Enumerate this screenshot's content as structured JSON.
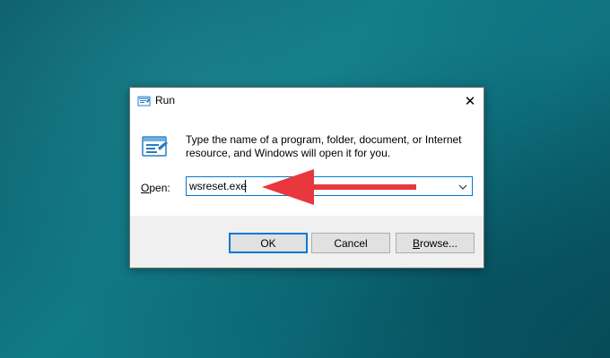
{
  "dialog": {
    "title": "Run",
    "close_glyph": "✕",
    "description": "Type the name of a program, folder, document, or Internet resource, and Windows will open it for you.",
    "open_label_accel": "O",
    "open_label_rest": "pen:",
    "open_value": "wsreset.exe",
    "buttons": {
      "ok": "OK",
      "cancel": "Cancel",
      "browse_accel": "B",
      "browse_rest": "rowse..."
    }
  },
  "icons": {
    "title": "run-icon",
    "content": "run-icon-large",
    "close": "close-icon",
    "dropdown": "chevron-down-icon",
    "annotation": "red-arrow-icon"
  },
  "colors": {
    "desktop": "#0f7380",
    "accent": "#0078d7",
    "footer": "#f0f0f0",
    "annotation_arrow": "#e8373d"
  }
}
